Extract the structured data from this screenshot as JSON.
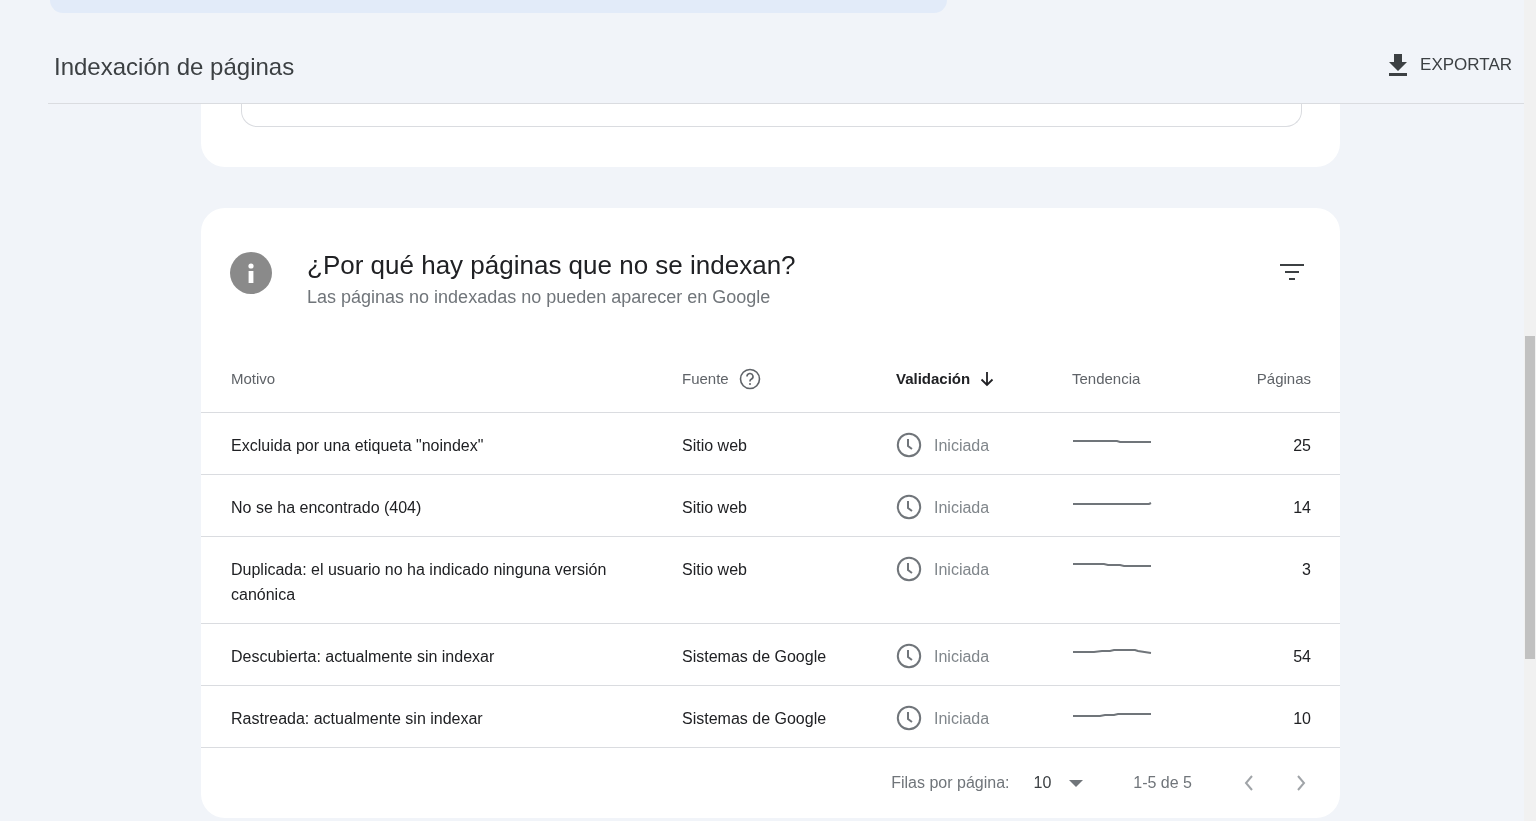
{
  "header": {
    "title": "Indexación de páginas",
    "export_button": "EXPORTAR"
  },
  "card": {
    "title": "¿Por qué hay páginas que no se indexan?",
    "subtitle": "Las páginas no indexadas no pueden aparecer en Google",
    "columns": [
      {
        "label": "Motivo",
        "sorted": false
      },
      {
        "label": "Fuente",
        "sorted": false
      },
      {
        "label": "Validación",
        "sorted": true
      },
      {
        "label": "Tendencia",
        "sorted": false
      },
      {
        "label": "Páginas",
        "sorted": false
      }
    ],
    "rows": [
      {
        "reason": "Excluida por una etiqueta \"noindex\"",
        "source": "Sitio web",
        "validation": "Iniciada",
        "pages": "25"
      },
      {
        "reason": "No se ha encontrado (404)",
        "source": "Sitio web",
        "validation": "Iniciada",
        "pages": "14"
      },
      {
        "reason": "Duplicada: el usuario no ha indicado ninguna versión canónica",
        "source": "Sitio web",
        "validation": "Iniciada",
        "pages": "3"
      },
      {
        "reason": "Descubierta: actualmente sin indexar",
        "source": "Sistemas de Google",
        "validation": "Iniciada",
        "pages": "54"
      },
      {
        "reason": "Rastreada: actualmente sin indexar",
        "source": "Sistemas de Google",
        "validation": "Iniciada",
        "pages": "10"
      }
    ],
    "footer": {
      "rows_label": "Filas por página:",
      "rows_value": "10",
      "range": "1-5 de 5"
    }
  }
}
